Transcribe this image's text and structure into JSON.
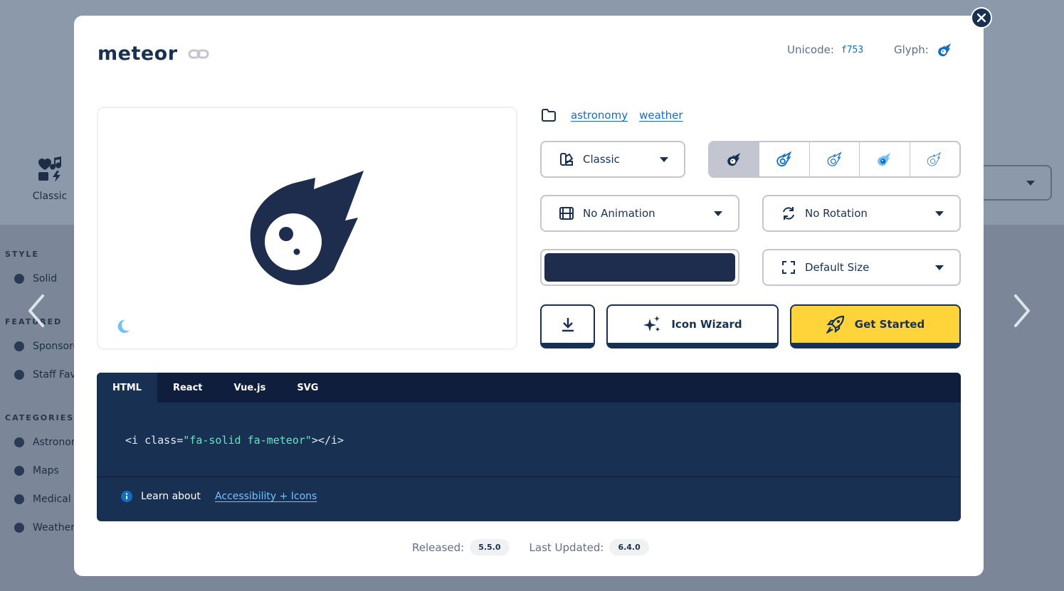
{
  "background": {
    "classic_label": "Classic",
    "sections": [
      {
        "label": "STYLE",
        "items": [
          "Solid"
        ]
      },
      {
        "label": "FEATURED",
        "items": [
          "Sponsored",
          "Staff Favorites"
        ]
      },
      {
        "label": "CATEGORIES",
        "items": [
          "Astronomy",
          "Maps",
          "Medical + Health",
          "Weather"
        ]
      }
    ]
  },
  "modal": {
    "title": "meteor",
    "unicode_label": "Unicode:",
    "unicode_value": "f753",
    "glyph_label": "Glyph:",
    "categories": [
      "astronomy",
      "weather"
    ],
    "family_select": "Classic",
    "animation_select": "No Animation",
    "rotation_select": "No Rotation",
    "size_select": "Default Size",
    "color_value": "#1e2d4d",
    "style_variants": [
      "solid",
      "regular",
      "light",
      "duotone",
      "thin"
    ],
    "buttons": {
      "download": "",
      "wizard": "Icon Wizard",
      "get_started": "Get Started"
    },
    "code_tabs": [
      "HTML",
      "React",
      "Vue.js",
      "SVG"
    ],
    "code": {
      "prefix": "<i class=",
      "string": "\"fa-solid fa-meteor\"",
      "suffix": "></i>"
    },
    "learn_prefix": "Learn about",
    "learn_link": "Accessibility + Icons",
    "released_label": "Released:",
    "released_value": "5.5.0",
    "updated_label": "Last Updated:",
    "updated_value": "6.4.0"
  },
  "colors": {
    "navy": "#183153",
    "accent_blue": "#146ebe",
    "yellow": "#ffd43b"
  }
}
